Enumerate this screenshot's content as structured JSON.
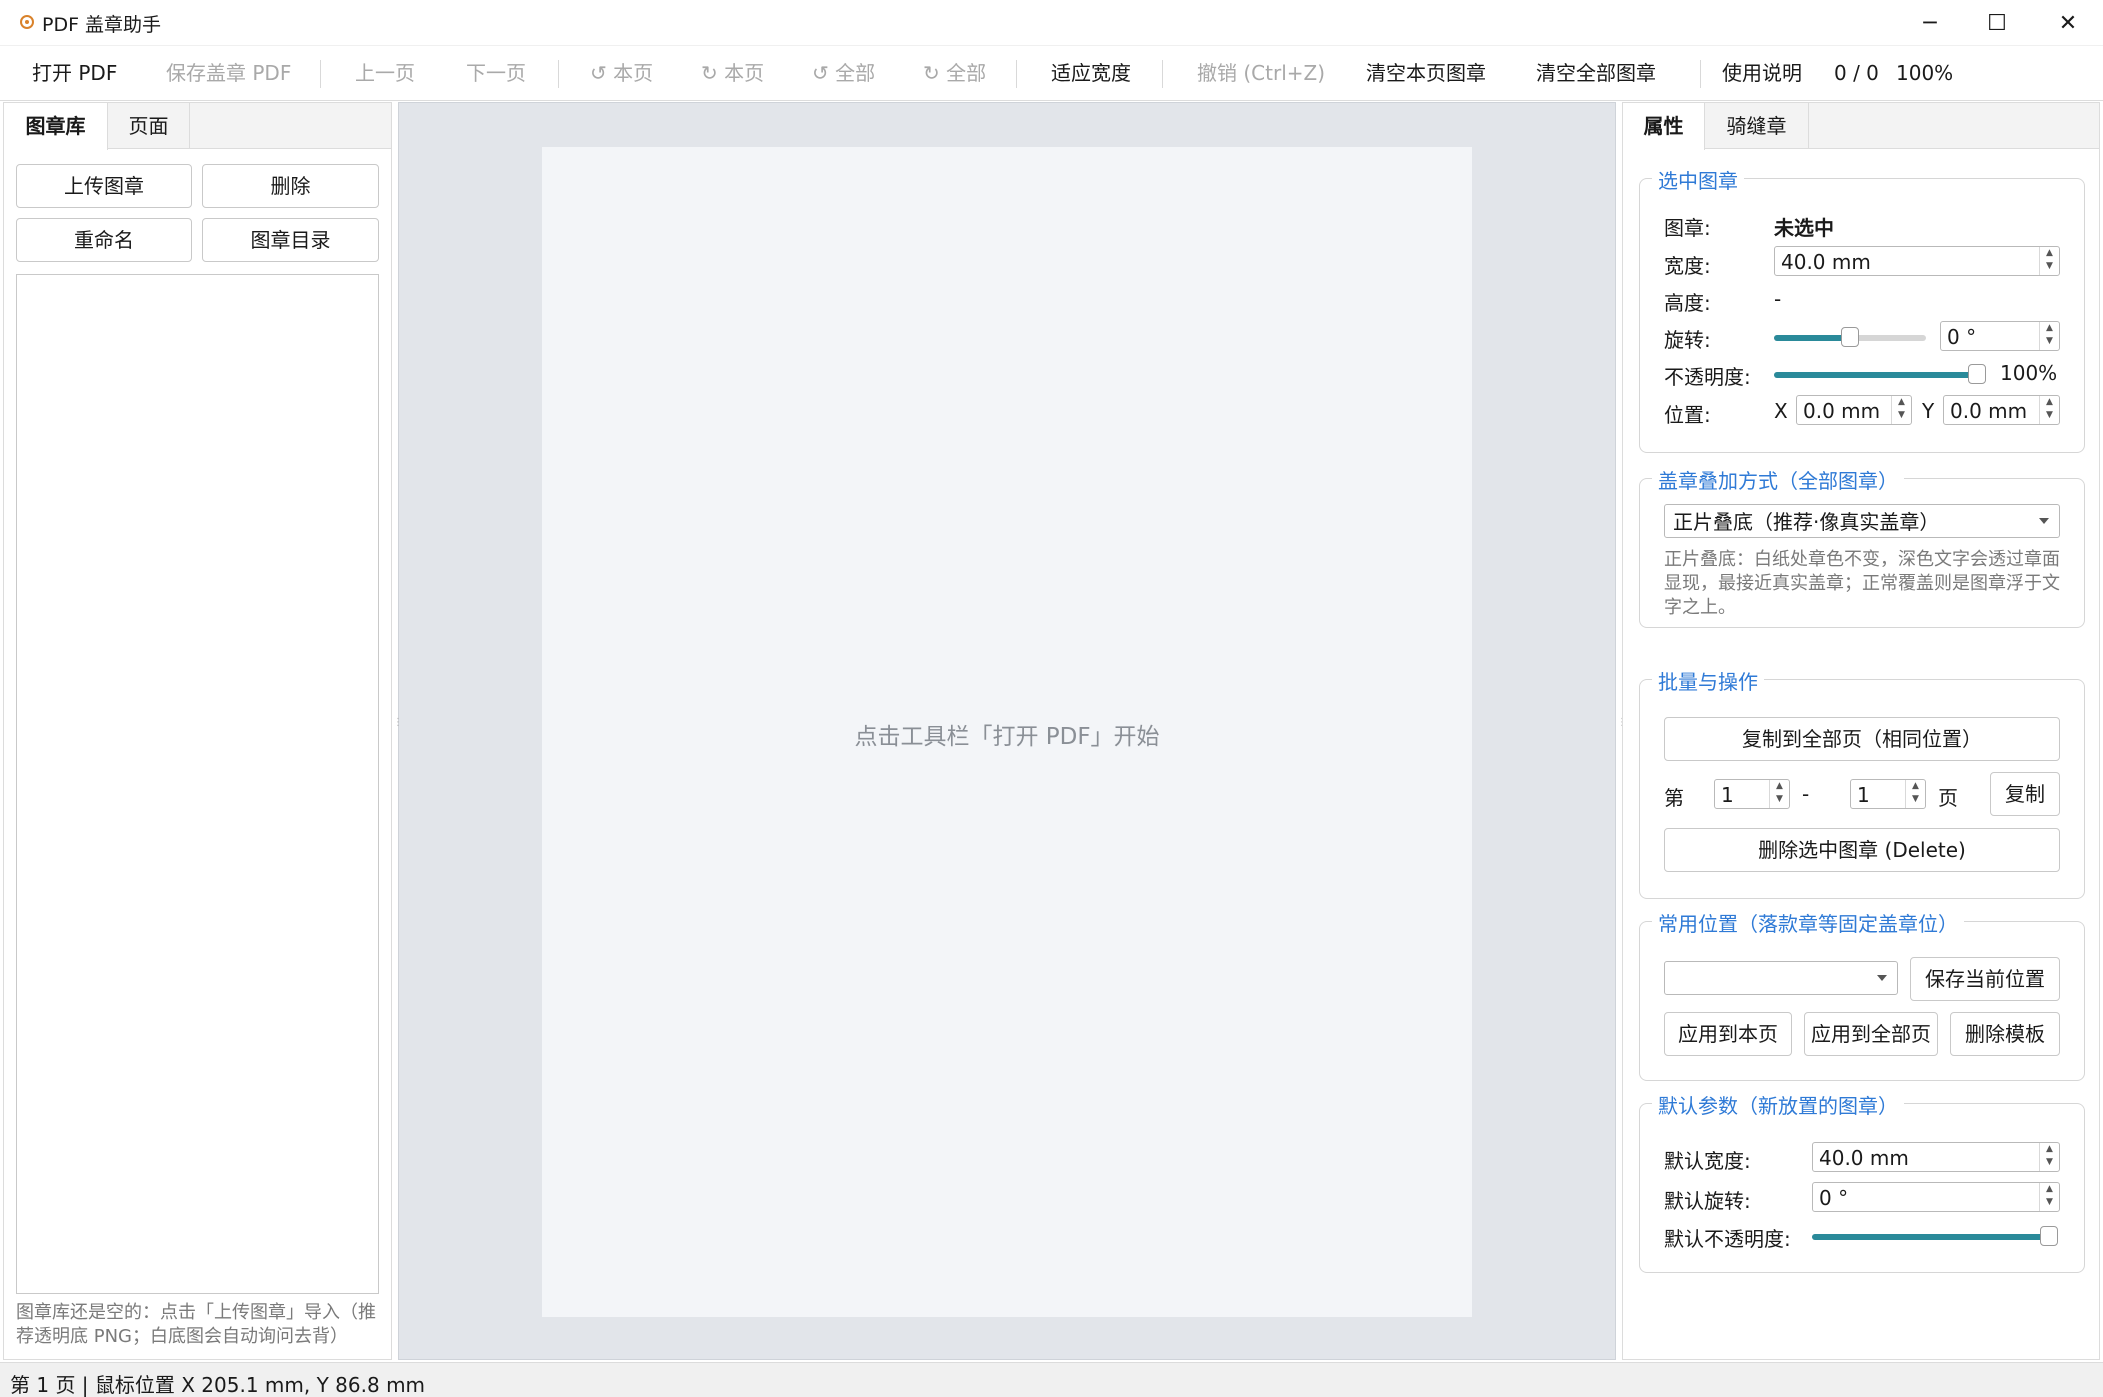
{
  "window": {
    "title": "PDF 盖章助手",
    "minimize": "─",
    "maximize": "☐",
    "close": "✕"
  },
  "toolbar": {
    "open_pdf": "打开 PDF",
    "save_pdf": "保存盖章 PDF",
    "prev_page": "上一页",
    "next_page": "下一页",
    "rotate_left_page": "↺ 本页",
    "rotate_right_page": "↻ 本页",
    "rotate_left_all": "↺ 全部",
    "rotate_right_all": "↻ 全部",
    "fit_width": "适应宽度",
    "undo": "撤销 (Ctrl+Z)",
    "clear_page": "清空本页图章",
    "clear_all": "清空全部图章",
    "help": "使用说明",
    "page_count": "0 / 0",
    "zoom": "100%"
  },
  "left_panel": {
    "tabs": [
      "图章库",
      "页面"
    ],
    "upload": "上传图章",
    "delete": "删除",
    "rename": "重命名",
    "stamp_dir": "图章目录",
    "hint": "图章库还是空的：点击「上传图章」导入（推荐透明底 PNG；白底图会自动询问去背）"
  },
  "center": {
    "placeholder": "点击工具栏「打开 PDF」开始"
  },
  "right_panel": {
    "tabs": [
      "属性",
      "骑缝章"
    ],
    "selected": {
      "title": "选中图章",
      "stamp_label": "图章:",
      "stamp_value": "未选中",
      "width_label": "宽度:",
      "width_value": "40.0 mm",
      "height_label": "高度:",
      "height_value": "-",
      "rotate_label": "旋转:",
      "rotate_value": "0 °",
      "rotate_level": 0.5,
      "opacity_label": "不透明度:",
      "opacity_value": "100%",
      "opacity_level": 1.0,
      "position_label": "位置:",
      "x_label": "X",
      "x_value": "0.0 mm",
      "y_label": "Y",
      "y_value": "0.0 mm"
    },
    "blend": {
      "title": "盖章叠加方式（全部图章）",
      "mode": "正片叠底（推荐·像真实盖章）",
      "desc": "正片叠底：白纸处章色不变，深色文字会透过章面显现，最接近真实盖章；正常覆盖则是图章浮于文字之上。"
    },
    "batch": {
      "title": "批量与操作",
      "copy_all": "复制到全部页（相同位置）",
      "from_label": "第",
      "from_value": "1",
      "dash": "-",
      "to_value": "1",
      "page_label": "页",
      "copy": "复制",
      "delete_selected": "删除选中图章 (Delete)"
    },
    "positions": {
      "title": "常用位置（落款章等固定盖章位）",
      "save_current": "保存当前位置",
      "apply_page": "应用到本页",
      "apply_all": "应用到全部页",
      "delete_template": "删除模板"
    },
    "defaults": {
      "title": "默认参数（新放置的图章）",
      "width_label": "默认宽度:",
      "width_value": "40.0 mm",
      "rotate_label": "默认旋转:",
      "rotate_value": "0 °",
      "opacity_label": "默认不透明度:",
      "opacity_level": 1.0
    }
  },
  "status": {
    "text": "第 1 页 | 鼠标位置 X 205.1 mm, Y 86.8 mm"
  },
  "colors": {
    "accent": "#2f7ad6",
    "slider_fill": "#2a8a9a",
    "canvas_bg": "#e2e5ea"
  }
}
